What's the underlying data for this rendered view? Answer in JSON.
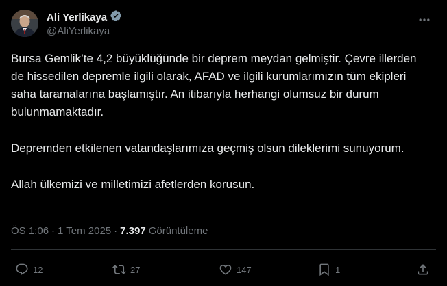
{
  "author": {
    "display_name": "Ali Yerlikaya",
    "handle": "@AliYerlikaya",
    "verified_badge": "gray-verified-badge-icon",
    "badge_color": "#829aab"
  },
  "tweet": {
    "paragraphs": [
      "Bursa Gemlik’te 4,2 büyüklüğünde bir deprem meydan gelmiştir. Çevre illerden de hissedilen depremle ilgili olarak, AFAD ve ilgili kurumlarımızın tüm ekipleri saha taramalarına başlamıştır. An itibarıyla herhangi olumsuz bir durum bulunmamaktadır.",
      "Depremden etkilenen vatandaşlarımıza geçmiş olsun dileklerimi sunuyorum.",
      "Allah ülkemizi ve milletimizi afetlerden korusun."
    ]
  },
  "meta": {
    "time": "ÖS 1:06",
    "separator": "·",
    "date": "1 Tem 2025",
    "views_count": "7.397",
    "views_label": "Görüntüleme"
  },
  "actions": {
    "replies": "12",
    "reposts": "27",
    "likes": "147",
    "bookmarks": "1"
  },
  "colors": {
    "background": "#000000",
    "text": "#e7e9ea",
    "muted": "#71767b",
    "divider": "#2f3336"
  }
}
